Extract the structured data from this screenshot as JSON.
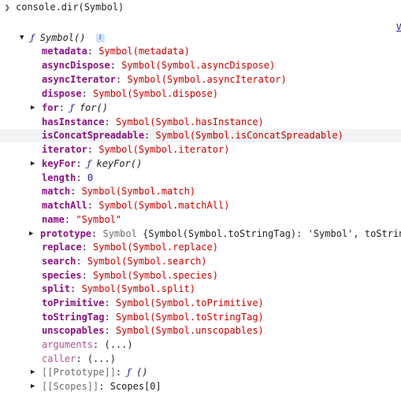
{
  "console": {
    "input": "console.dir(Symbol)",
    "prompt_glyph": "❯",
    "right_link": "V"
  },
  "root": {
    "f_glyph": "ƒ",
    "name": "Symbol()",
    "info_badge": "i"
  },
  "props": [
    {
      "key": "metadata",
      "value": "Symbol(metadata)"
    },
    {
      "key": "asyncDispose",
      "value": "Symbol(Symbol.asyncDispose)"
    },
    {
      "key": "asyncIterator",
      "value": "Symbol(Symbol.asyncIterator)"
    },
    {
      "key": "dispose",
      "value": "Symbol(Symbol.dispose)"
    },
    {
      "key": "for",
      "f_glyph": "ƒ",
      "value": "for()"
    },
    {
      "key": "hasInstance",
      "value": "Symbol(Symbol.hasInstance)"
    },
    {
      "key": "isConcatSpreadable",
      "value": "Symbol(Symbol.isConcatSpreadable)"
    },
    {
      "key": "iterator",
      "value": "Symbol(Symbol.iterator)"
    },
    {
      "key": "keyFor",
      "f_glyph": "ƒ",
      "value": "keyFor()"
    },
    {
      "key": "length",
      "value": "0"
    },
    {
      "key": "match",
      "value": "Symbol(Symbol.match)"
    },
    {
      "key": "matchAll",
      "value": "Symbol(Symbol.matchAll)"
    },
    {
      "key": "name",
      "value": "\"Symbol\""
    },
    {
      "key": "prototype",
      "class_name": "Symbol",
      "value": "{Symbol(Symbol.toStringTag): 'Symbol', toString"
    },
    {
      "key": "replace",
      "value": "Symbol(Symbol.replace)"
    },
    {
      "key": "search",
      "value": "Symbol(Symbol.search)"
    },
    {
      "key": "species",
      "value": "Symbol(Symbol.species)"
    },
    {
      "key": "split",
      "value": "Symbol(Symbol.split)"
    },
    {
      "key": "toPrimitive",
      "value": "Symbol(Symbol.toPrimitive)"
    },
    {
      "key": "toStringTag",
      "value": "Symbol(Symbol.toStringTag)"
    },
    {
      "key": "unscopables",
      "value": "Symbol(Symbol.unscopables)"
    },
    {
      "key": "arguments",
      "value": "(...)"
    },
    {
      "key": "caller",
      "value": "(...)"
    },
    {
      "key": "[[Prototype]]",
      "f_glyph": "ƒ",
      "value": "()"
    },
    {
      "key": "[[Scopes]]",
      "value": "Scopes[0]"
    }
  ],
  "arrows": {
    "collapsed": "▶",
    "expanded": "▼"
  },
  "colon": ": ",
  "colors": {
    "key": "#881280",
    "symbol_value": "#c80000",
    "number_value": "#1a1aa6",
    "function_glyph": "#1a1aa6",
    "hover_row": "#f1f3f4"
  }
}
